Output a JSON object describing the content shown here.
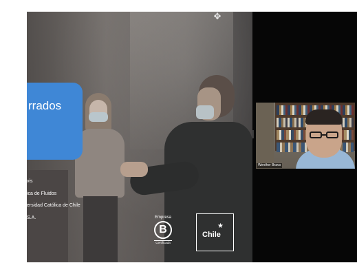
{
  "shared_screen": {
    "move_icon": "move-arrows-icon",
    "title_fragment": "rrados",
    "credits": [
      "vis",
      "ica de Fluidos",
      "ersidad Católica de Chile",
      "S.A."
    ],
    "b_corp": {
      "top": "Empresa",
      "letter": "B",
      "bottom": "Certificada"
    },
    "chile_logo": {
      "text": "Chile",
      "star": "★"
    },
    "title_card_color": "#3f87d6"
  },
  "side_panel": {
    "background": "#060606",
    "participant": {
      "name": "Wenther Bravo"
    }
  }
}
